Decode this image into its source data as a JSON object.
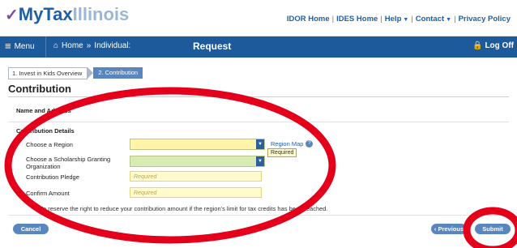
{
  "header": {
    "logo_my": "My",
    "logo_tax": "Tax",
    "logo_state": "Illinois",
    "links": [
      "IDOR Home",
      "IDES Home",
      "Help",
      "Contact",
      "Privacy Policy"
    ]
  },
  "navbar": {
    "menu_label": "Menu",
    "home_label": "Home",
    "breadcrumb_sep": "»",
    "breadcrumb": "Individual:",
    "title": "Request",
    "logoff": "Log Off"
  },
  "steps": [
    "1. Invest in Kids Overview",
    "2. Contribution"
  ],
  "page_title": "Contribution",
  "sections": {
    "name_address": "Name and Address",
    "contribution_details": "Contribution Details"
  },
  "fields": {
    "region_label": "Choose a Region",
    "sgo_label": "Choose a Scholarship Granting Organization",
    "pledge_label": "Contribution Pledge",
    "pledge_placeholder": "Required",
    "confirm_label": "Confirm Amount",
    "confirm_placeholder": "Required"
  },
  "region_map": "Region Map",
  "tooltip": "Required",
  "note": "We reserve the right to reduce your contribution amount if the region's limit for tax credits has been reached.",
  "buttons": {
    "cancel": "Cancel",
    "previous": "Previous",
    "submit": "Submit"
  },
  "colors": {
    "brand_blue": "#1d5a9c",
    "accent_blue": "#5a86c0",
    "annotation_red": "#e4001b"
  }
}
